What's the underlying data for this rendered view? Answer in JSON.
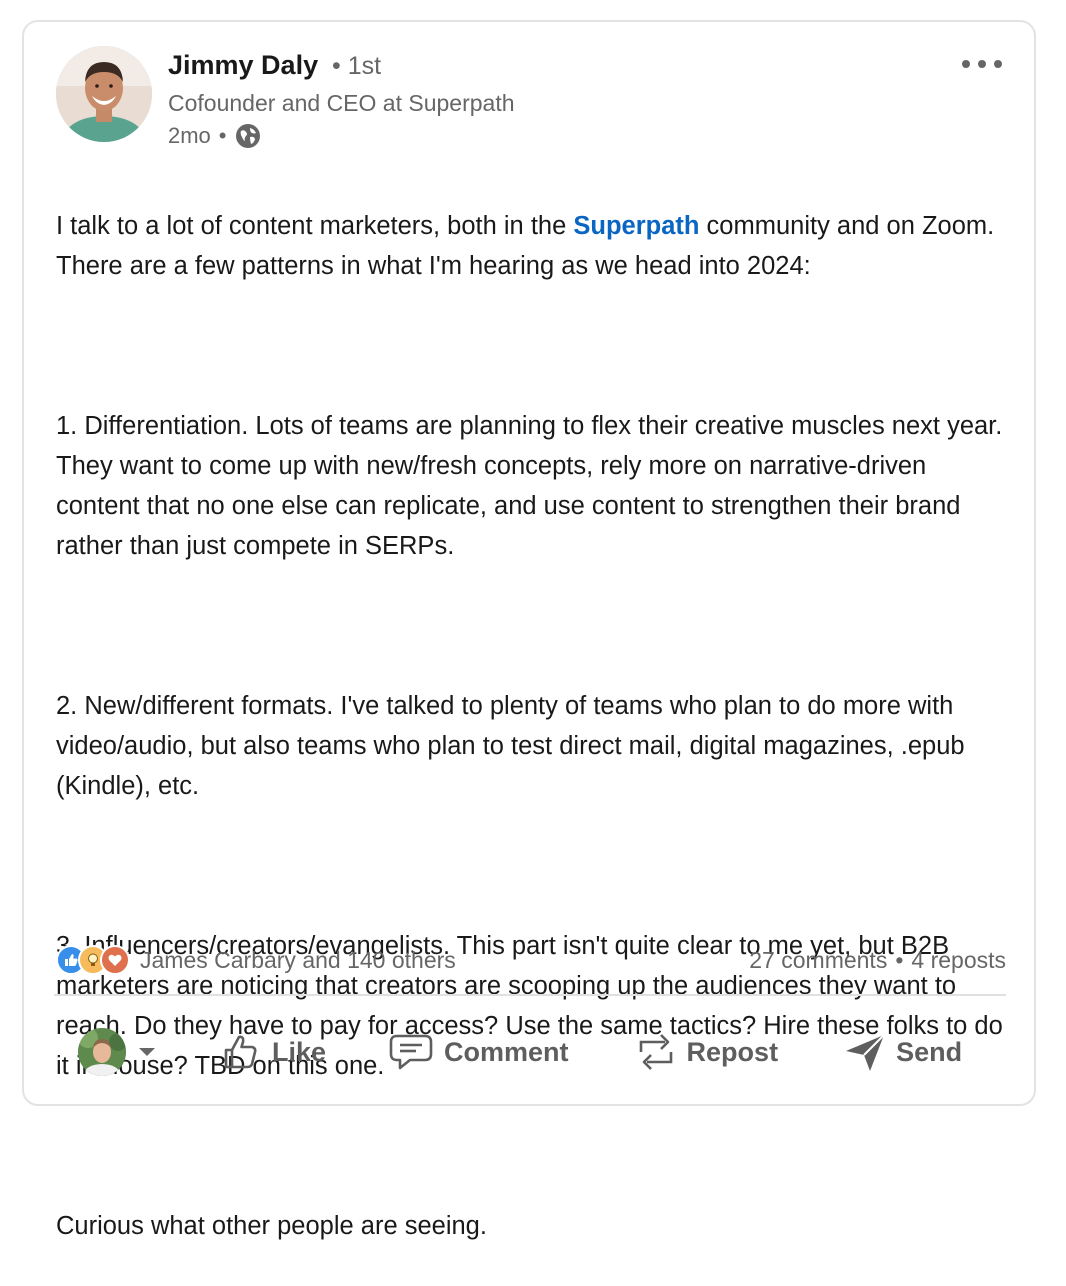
{
  "post": {
    "author": {
      "name": "Jimmy Daly",
      "degree": "• 1st",
      "headline": "Cofounder and CEO at Superpath",
      "time": "2mo",
      "dot": "•",
      "visibility_icon": "globe-icon"
    },
    "more_icon": "more-horizontal-icon",
    "body": {
      "p1_before": "I talk to a lot of content marketers, both in the ",
      "p1_mention": "Superpath",
      "p1_after": " community and on Zoom. There are a few patterns in what I'm hearing as we head into 2024:",
      "p2": "1. Differentiation. Lots of teams are planning to flex their creative muscles next year. They want to come up with new/fresh concepts, rely more on narrative-driven content that no one else can replicate, and use content to strengthen their brand rather than just compete in SERPs.",
      "p3": "2. New/different formats. I've talked to plenty of teams who plan to do more with video/audio, but also teams who plan to test direct mail, digital magazines, .epub (Kindle), etc.",
      "p4": "3. Influencers/creators/evangelists. This part isn't quite clear to me yet, but B2B marketers are noticing that creators are scooping up the audiences they want to reach. Do they have to pay for access? Use the same tactics? Hire these folks to do it in-house? TBD on this one.",
      "p5": "Curious what other people are seeing."
    },
    "social": {
      "reaction_icons": [
        "like-reaction-icon",
        "insightful-reaction-icon",
        "love-reaction-icon"
      ],
      "reactors_text": "James Carbary and 140 others",
      "comments": "27 comments",
      "sep": "•",
      "reposts": "4 reposts"
    },
    "actions": {
      "like": "Like",
      "comment": "Comment",
      "repost": "Repost",
      "send": "Send"
    }
  },
  "colors": {
    "text": "#191919",
    "secondary": "#666666",
    "link": "#0a66c2",
    "action": "#5e5e5e",
    "border": "#e3e3e3"
  }
}
